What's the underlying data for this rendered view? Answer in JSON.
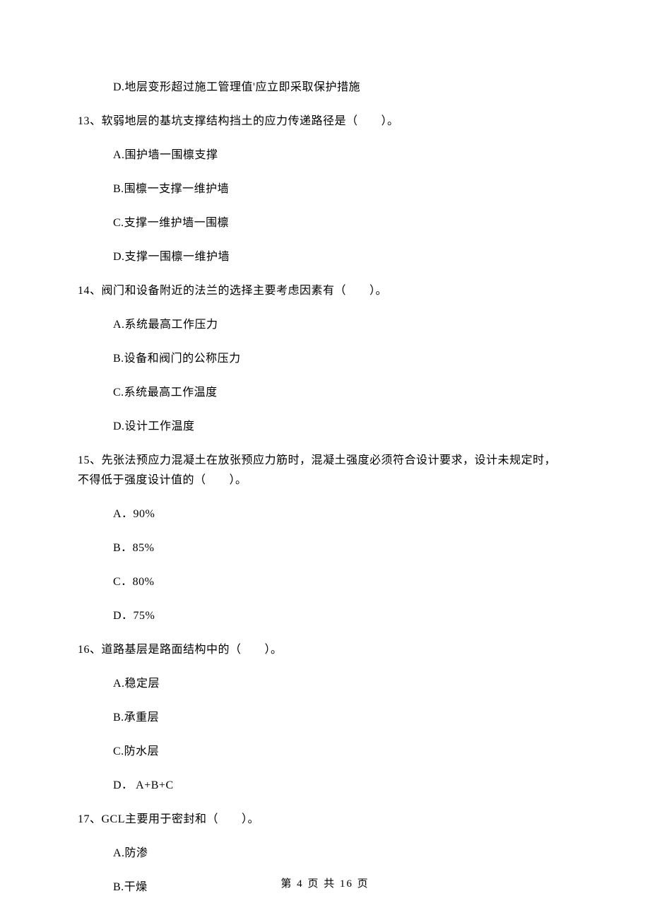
{
  "orphan_option": {
    "d": "D.地层变形超过施工管理值'应立即采取保护措施"
  },
  "q13": {
    "stem": "13、软弱地层的基坑支撑结构挡土的应力传递路径是（　　）。",
    "a": "A.围护墙一围檩支撑",
    "b": "B.围檩一支撑一维护墙",
    "c": "C.支撑一维护墙一围檩",
    "d": "D.支撑一围檩一维护墙"
  },
  "q14": {
    "stem": "14、阀门和设备附近的法兰的选择主要考虑因素有（　　）。",
    "a": "A.系统最高工作压力",
    "b": "B.设备和阀门的公称压力",
    "c": "C.系统最高工作温度",
    "d": "D.设计工作温度"
  },
  "q15": {
    "stem_line1": "15、先张法预应力混凝土在放张预应力筋时，混凝土强度必须符合设计要求，设计未规定时，",
    "stem_line2": "不得低于强度设计值的（　　）。",
    "a": "A．90%",
    "b": "B．85%",
    "c": "C．80%",
    "d": "D．75%"
  },
  "q16": {
    "stem": "16、道路基层是路面结构中的（　　）。",
    "a": "A.稳定层",
    "b": "B.承重层",
    "c": "C.防水层",
    "d": "D． A+B+C"
  },
  "q17": {
    "stem": "17、GCL主要用于密封和（　　）。",
    "a": "A.防渗",
    "b": "B.干燥"
  },
  "footer": "第 4 页 共 16 页"
}
